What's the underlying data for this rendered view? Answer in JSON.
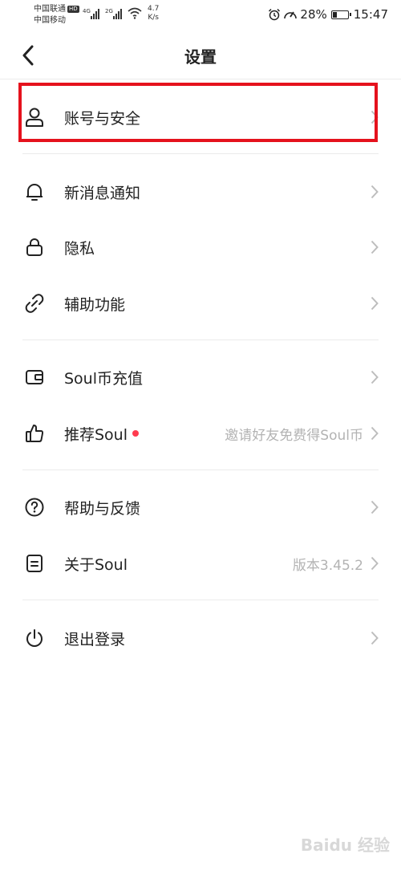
{
  "status_bar": {
    "carrier1": "中国联通",
    "hd": "HD",
    "carrier2": "中国移动",
    "net1": "4G",
    "net2": "2G",
    "speed_value": "4.7",
    "speed_unit": "K/s",
    "battery": "28%",
    "battery_level": 0.28,
    "time": "15:47"
  },
  "header": {
    "title": "设置",
    "back_icon": "chevron-left-icon"
  },
  "menu": {
    "account": {
      "label": "账号与安全",
      "icon": "user-icon"
    },
    "notify": {
      "label": "新消息通知",
      "icon": "bell-icon"
    },
    "privacy": {
      "label": "隐私",
      "icon": "lock-icon"
    },
    "assist": {
      "label": "辅助功能",
      "icon": "link-icon"
    },
    "recharge": {
      "label": "Soul币充值",
      "icon": "wallet-icon"
    },
    "recommend": {
      "label": "推荐Soul",
      "icon": "thumbs-up-icon",
      "value": "邀请好友免费得Soul币",
      "dot_color": "#ff3b4f"
    },
    "help": {
      "label": "帮助与反馈",
      "icon": "question-icon"
    },
    "about": {
      "label": "关于Soul",
      "icon": "document-icon",
      "value": "版本3.45.2"
    },
    "logout": {
      "label": "退出登录",
      "icon": "power-icon"
    }
  },
  "highlight_color": "#e5121d",
  "watermark": "Baidu 经验"
}
